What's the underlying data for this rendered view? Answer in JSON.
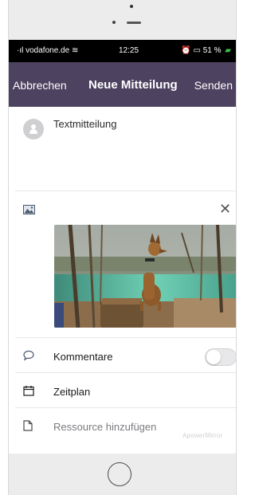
{
  "status_bar": {
    "carrier": "vodafone.de",
    "time": "12:25",
    "battery_percent": "51 %",
    "battery_color": "#3fc24a"
  },
  "navbar": {
    "cancel_label": "Abbrechen",
    "title": "Neue Mitteilung",
    "send_label": "Senden",
    "background_color": "#4d4260"
  },
  "composer": {
    "message_placeholder": "Textmitteilung",
    "attachment_icon": "image-icon",
    "remove_icon": "close-icon"
  },
  "options": {
    "comments_label": "Kommentare",
    "comments_enabled": false,
    "schedule_label": "Zeitplan",
    "add_resource_label": "Ressource hinzufügen"
  },
  "watermark": "ApowerMirror"
}
